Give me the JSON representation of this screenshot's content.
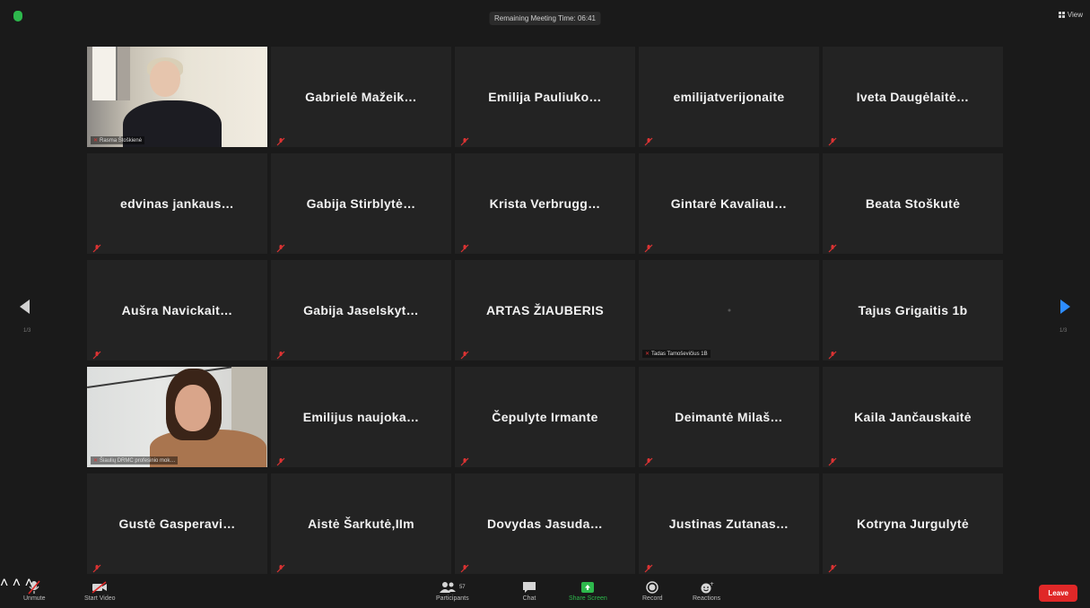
{
  "header": {
    "meeting_timer": "Remaining Meeting Time: 06:41",
    "view_label": "View"
  },
  "gallery": {
    "page_left": "1/3",
    "page_right": "1/3",
    "tiles": [
      {
        "type": "video1",
        "name": "",
        "tag": "Rasma Štoškienė"
      },
      {
        "type": "name",
        "name": "Gabrielė  Mažeik…",
        "tag": ""
      },
      {
        "type": "name",
        "name": "Emilija  Pauliuko…",
        "tag": ""
      },
      {
        "type": "name",
        "name": "emilijatverijonaite",
        "tag": ""
      },
      {
        "type": "name",
        "name": "Iveta  Daugėlaitė…",
        "tag": ""
      },
      {
        "type": "name",
        "name": "edvinas  jankaus…",
        "tag": ""
      },
      {
        "type": "name",
        "name": "Gabija  Stirblytė…",
        "tag": ""
      },
      {
        "type": "name",
        "name": "Krista  Verbrugg…",
        "tag": ""
      },
      {
        "type": "name",
        "name": "Gintarė  Kavaliau…",
        "tag": ""
      },
      {
        "type": "name",
        "name": "Beata  Stoškutė",
        "tag": ""
      },
      {
        "type": "name",
        "name": "Aušra  Navickait…",
        "tag": ""
      },
      {
        "type": "name",
        "name": "Gabija  Jaselskyt…",
        "tag": ""
      },
      {
        "type": "name",
        "name": "ARTAS  ŽIAUBERIS",
        "tag": ""
      },
      {
        "type": "blank",
        "name": "",
        "tag": "Tadas Tamoševičius 1B"
      },
      {
        "type": "name",
        "name": "Tajus  Grigaitis  1b",
        "tag": ""
      },
      {
        "type": "video2",
        "name": "",
        "tag": "Šiaulių DRMC profesinio mok…"
      },
      {
        "type": "name",
        "name": "Emilijus  naujoka…",
        "tag": ""
      },
      {
        "type": "name",
        "name": "Čepulyte  Irmante",
        "tag": ""
      },
      {
        "type": "name",
        "name": "Deimantė  Milaš…",
        "tag": ""
      },
      {
        "type": "name",
        "name": "Kaila  Jančauskaitė",
        "tag": ""
      },
      {
        "type": "name",
        "name": "Gustė  Gasperavi…",
        "tag": ""
      },
      {
        "type": "name",
        "name": "Aistė  Šarkutė,IIm",
        "tag": ""
      },
      {
        "type": "name",
        "name": "Dovydas  Jasuda…",
        "tag": ""
      },
      {
        "type": "name",
        "name": "Justinas  Zutanas…",
        "tag": ""
      },
      {
        "type": "name",
        "name": "Kotryna  Jurgulytė",
        "tag": ""
      }
    ]
  },
  "toolbar": {
    "unmute": "Unmute",
    "start_video": "Start Video",
    "participants": "Participants",
    "participants_count": "57",
    "chat": "Chat",
    "share_screen": "Share Screen",
    "record": "Record",
    "reactions": "Reactions",
    "leave": "Leave"
  },
  "colors": {
    "accent_share": "#2db84c",
    "leave_red": "#e02828",
    "active_speaker": "#c5d64a",
    "next_arrow": "#2d8cff"
  }
}
